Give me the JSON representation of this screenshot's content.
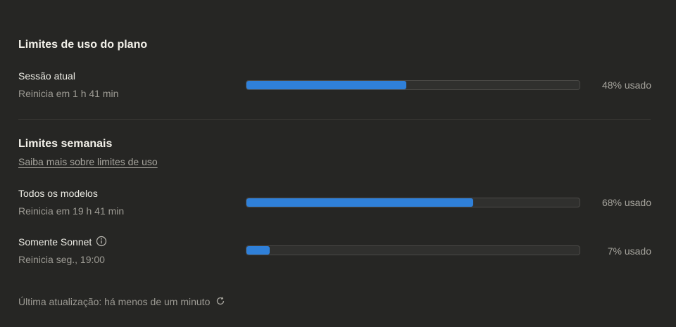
{
  "plan_limits": {
    "title": "Limites de uso do plano",
    "current_session": {
      "label": "Sessão atual",
      "reset": "Reinicia em 1 h 41 min",
      "percent_text": "48% usado",
      "percent": 48
    }
  },
  "weekly_limits": {
    "title": "Limites semanais",
    "learn_more": "Saiba mais sobre limites de uso",
    "all_models": {
      "label": "Todos os modelos",
      "reset": "Reinicia em 19 h 41 min",
      "percent_text": "68% usado",
      "percent": 68
    },
    "sonnet_only": {
      "label": "Somente Sonnet",
      "icon": "info-icon",
      "reset": "Reinicia seg., 19:00",
      "percent_text": "7% usado",
      "percent": 7
    }
  },
  "footer": {
    "last_update": "Última atualização: há menos de um minuto",
    "icon": "refresh-icon"
  },
  "colors": {
    "background": "#262624",
    "bar_fill": "#2f80d9",
    "bar_track": "#30302e"
  }
}
